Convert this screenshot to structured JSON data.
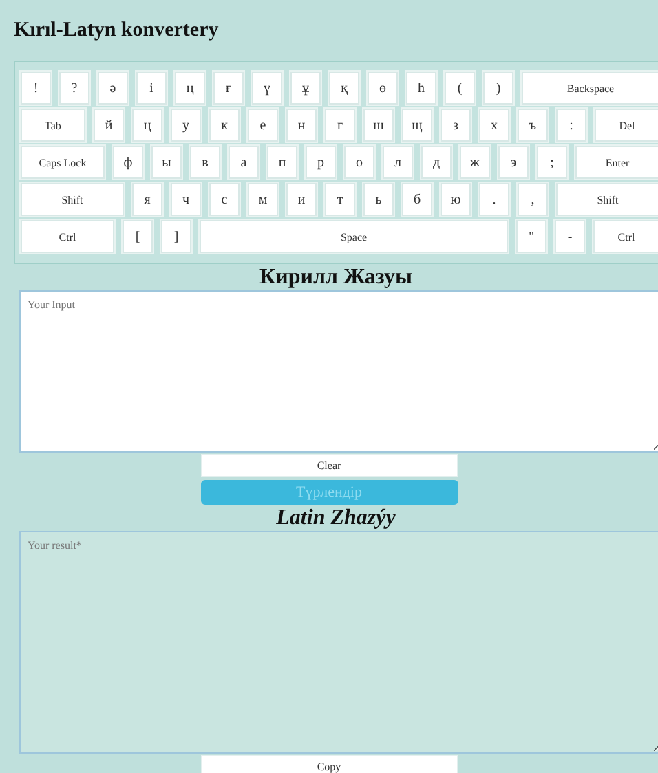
{
  "title": "Kırıl-Latyn konvertery",
  "keyboard": [
    [
      {
        "label": "!",
        "kind": "char"
      },
      {
        "label": "?",
        "kind": "char"
      },
      {
        "label": "ә",
        "kind": "char"
      },
      {
        "label": "і",
        "kind": "char"
      },
      {
        "label": "ң",
        "kind": "char"
      },
      {
        "label": "ғ",
        "kind": "char"
      },
      {
        "label": "ү",
        "kind": "char"
      },
      {
        "label": "ұ",
        "kind": "char"
      },
      {
        "label": "қ",
        "kind": "char"
      },
      {
        "label": "ө",
        "kind": "char"
      },
      {
        "label": "һ",
        "kind": "char"
      },
      {
        "label": "(",
        "kind": "char"
      },
      {
        "label": ")",
        "kind": "char"
      },
      {
        "label": "Backspace",
        "kind": "control"
      }
    ],
    [
      {
        "label": "Tab",
        "kind": "control"
      },
      {
        "label": "й",
        "kind": "char"
      },
      {
        "label": "ц",
        "kind": "char"
      },
      {
        "label": "у",
        "kind": "char"
      },
      {
        "label": "к",
        "kind": "char"
      },
      {
        "label": "е",
        "kind": "char"
      },
      {
        "label": "н",
        "kind": "char"
      },
      {
        "label": "г",
        "kind": "char"
      },
      {
        "label": "ш",
        "kind": "char"
      },
      {
        "label": "щ",
        "kind": "char"
      },
      {
        "label": "з",
        "kind": "char"
      },
      {
        "label": "х",
        "kind": "char"
      },
      {
        "label": "ъ",
        "kind": "char"
      },
      {
        "label": ":",
        "kind": "char"
      },
      {
        "label": "Del",
        "kind": "control"
      }
    ],
    [
      {
        "label": "Caps Lock",
        "kind": "control"
      },
      {
        "label": "ф",
        "kind": "char"
      },
      {
        "label": "ы",
        "kind": "char"
      },
      {
        "label": "в",
        "kind": "char"
      },
      {
        "label": "а",
        "kind": "char"
      },
      {
        "label": "п",
        "kind": "char"
      },
      {
        "label": "р",
        "kind": "char"
      },
      {
        "label": "о",
        "kind": "char"
      },
      {
        "label": "л",
        "kind": "char"
      },
      {
        "label": "д",
        "kind": "char"
      },
      {
        "label": "ж",
        "kind": "char"
      },
      {
        "label": "э",
        "kind": "char"
      },
      {
        "label": ";",
        "kind": "char"
      },
      {
        "label": "Enter",
        "kind": "control"
      }
    ],
    [
      {
        "label": "Shift",
        "kind": "control"
      },
      {
        "label": "я",
        "kind": "char"
      },
      {
        "label": "ч",
        "kind": "char"
      },
      {
        "label": "с",
        "kind": "char"
      },
      {
        "label": "м",
        "kind": "char"
      },
      {
        "label": "и",
        "kind": "char"
      },
      {
        "label": "т",
        "kind": "char"
      },
      {
        "label": "ь",
        "kind": "char"
      },
      {
        "label": "б",
        "kind": "char"
      },
      {
        "label": "ю",
        "kind": "char"
      },
      {
        "label": ".",
        "kind": "char"
      },
      {
        "label": ",",
        "kind": "char"
      },
      {
        "label": "Shift",
        "kind": "control"
      }
    ],
    [
      {
        "label": "Ctrl",
        "kind": "control"
      },
      {
        "label": "[",
        "kind": "char"
      },
      {
        "label": "]",
        "kind": "char"
      },
      {
        "label": "Space",
        "kind": "space"
      },
      {
        "label": "\"",
        "kind": "char"
      },
      {
        "label": "-",
        "kind": "char"
      },
      {
        "label": "Ctrl",
        "kind": "control"
      }
    ]
  ],
  "input_section": {
    "heading": "Кирилл Жазуы",
    "placeholder": "Your Input",
    "buttons": [
      {
        "label": "Clear",
        "kind": "plain"
      },
      {
        "label": "Түрлендір",
        "kind": "primary"
      }
    ]
  },
  "output_section": {
    "heading": "Latin Zhazýy",
    "placeholder": "Your result*",
    "buttons": [
      {
        "label": "Copy",
        "kind": "plain"
      }
    ]
  }
}
